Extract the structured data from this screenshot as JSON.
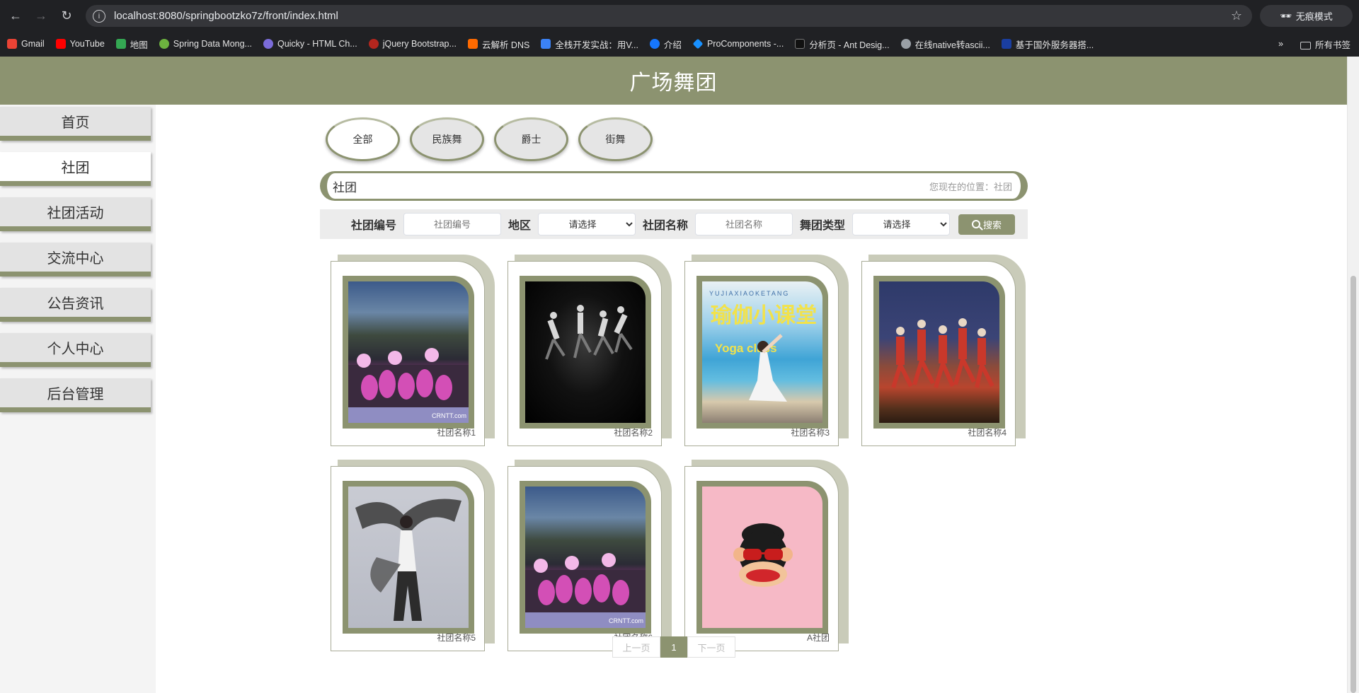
{
  "browser": {
    "url": "localhost:8080/springbootzko7z/front/index.html",
    "incognito_label": "无痕模式",
    "bookmarks": [
      {
        "label": "Gmail",
        "color": "#ea4335"
      },
      {
        "label": "YouTube",
        "color": "#ff0000"
      },
      {
        "label": "地图",
        "color": "#34a853"
      },
      {
        "label": "Spring Data Mong...",
        "color": "#6db33f"
      },
      {
        "label": "Quicky - HTML Ch...",
        "color": "#7b6cd9"
      },
      {
        "label": "jQuery Bootstrap...",
        "color": "#b3261e"
      },
      {
        "label": "云解析 DNS",
        "color": "#ff6a00"
      },
      {
        "label": "全栈开发实战：用V...",
        "color": "#3b82f6"
      },
      {
        "label": "介绍",
        "color": "#1677ff"
      },
      {
        "label": "ProComponents -...",
        "color": "#1890ff"
      },
      {
        "label": "分析页 - Ant Desig...",
        "color": "#111111"
      },
      {
        "label": "在线native转ascii...",
        "color": "#9aa0a6"
      },
      {
        "label": "基于国外服务器搭...",
        "color": "#1a3ea0"
      }
    ],
    "all_bookmarks_label": "所有书签"
  },
  "header": {
    "title": "广场舞团"
  },
  "sidebar": {
    "items": [
      {
        "label": "首页",
        "active": false
      },
      {
        "label": "社团",
        "active": true
      },
      {
        "label": "社团活动",
        "active": false
      },
      {
        "label": "交流中心",
        "active": false
      },
      {
        "label": "公告资讯",
        "active": false
      },
      {
        "label": "个人中心",
        "active": false
      },
      {
        "label": "后台管理",
        "active": false
      }
    ]
  },
  "categories": [
    {
      "label": "全部",
      "active": true
    },
    {
      "label": "民族舞",
      "active": false
    },
    {
      "label": "爵士",
      "active": false
    },
    {
      "label": "街舞",
      "active": false
    }
  ],
  "breadcrumb": {
    "title": "社团",
    "location": "您现在的位置：社团"
  },
  "search": {
    "id_label": "社团编号",
    "id_placeholder": "社团编号",
    "region_label": "地区",
    "region_value": "请选择",
    "name_label": "社团名称",
    "name_placeholder": "社团名称",
    "type_label": "舞团类型",
    "type_value": "请选择",
    "button_label": "搜索"
  },
  "cards": [
    {
      "name": "社团名称1",
      "image": "fan-dance-group"
    },
    {
      "name": "社团名称2",
      "image": "modern-dance-jump"
    },
    {
      "name": "社团名称3",
      "image": "yoga-class"
    },
    {
      "name": "社团名称4",
      "image": "folk-dance-stage"
    },
    {
      "name": "社团名称5",
      "image": "sleeve-dancer"
    },
    {
      "name": "社团名称6",
      "image": "fan-dance-group"
    },
    {
      "name": "A社团",
      "image": "monkey-cartoon"
    }
  ],
  "photo_text": {
    "watermark": "CRNTT.com",
    "yoga_top": "YUJIAXIAOKETANG",
    "yoga_title": "瑜伽小课堂",
    "yoga_sub": "Yoga class"
  },
  "pagination": {
    "prev": "上一页",
    "current": "1",
    "next": "下一页"
  }
}
